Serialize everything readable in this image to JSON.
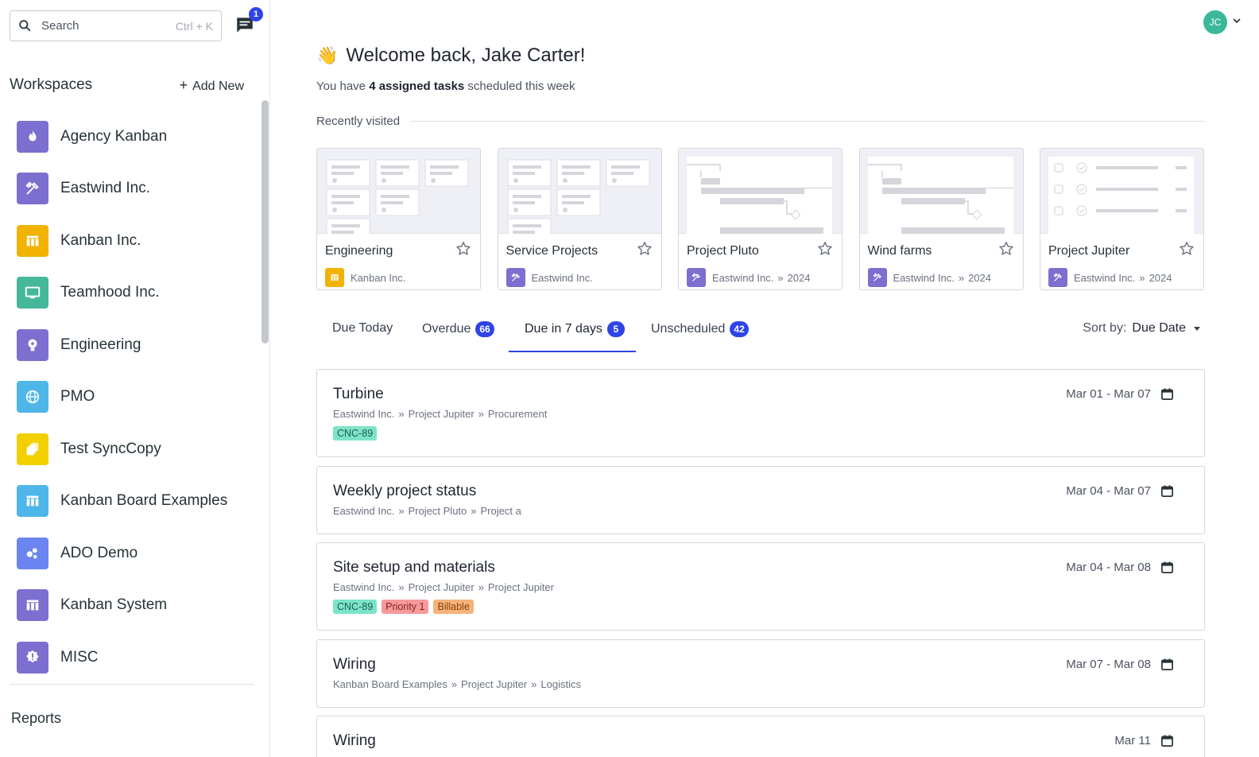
{
  "search": {
    "placeholder": "Search",
    "shortcut": "Ctrl + K"
  },
  "chat": {
    "badge": "1"
  },
  "sidebar": {
    "title": "Workspaces",
    "add_new": "Add New",
    "items": [
      {
        "label": "Agency Kanban",
        "icon": "fire-icon",
        "color": "#7c6fd0"
      },
      {
        "label": "Eastwind Inc.",
        "icon": "tools-icon",
        "color": "#7c6fd0"
      },
      {
        "label": "Kanban Inc.",
        "icon": "board-icon",
        "color": "#f2b200"
      },
      {
        "label": "Teamhood Inc.",
        "icon": "monitor-icon",
        "color": "#45b79a"
      },
      {
        "label": "Engineering",
        "icon": "bulb-icon",
        "color": "#7c6fd0"
      },
      {
        "label": "PMO",
        "icon": "globe-icon",
        "color": "#4fb6ea"
      },
      {
        "label": "Test SyncCopy",
        "icon": "copy-icon",
        "color": "#f2d000"
      },
      {
        "label": "Kanban Board Examples",
        "icon": "board-icon",
        "color": "#4fb6ea"
      },
      {
        "label": "ADO Demo",
        "icon": "bubbles-icon",
        "color": "#6b85f0"
      },
      {
        "label": "Kanban System",
        "icon": "board-icon",
        "color": "#7c6fd0"
      },
      {
        "label": "MISC",
        "icon": "alert-badge-icon",
        "color": "#7c6fd0"
      }
    ],
    "reports": "Reports"
  },
  "user": {
    "initials": "JC"
  },
  "welcome": {
    "emoji": "👋",
    "title": "Welcome back, Jake Carter!",
    "sub_prefix": "You have ",
    "sub_bold": "4 assigned tasks",
    "sub_suffix": " scheduled this week"
  },
  "recent": {
    "label": "Recently visited",
    "cards": [
      {
        "title": "Engineering",
        "thumb": "kanban",
        "workspace": "Kanban Inc.",
        "year": "",
        "icon": "board-icon",
        "color": "#f2b200"
      },
      {
        "title": "Service Projects",
        "thumb": "kanban",
        "workspace": "Eastwind Inc.",
        "year": "",
        "icon": "tools-icon",
        "color": "#7c6fd0"
      },
      {
        "title": "Project Pluto",
        "thumb": "gantt",
        "workspace": "Eastwind Inc.",
        "year": "2024",
        "icon": "tools-icon",
        "color": "#7c6fd0"
      },
      {
        "title": "Wind farms",
        "thumb": "gantt",
        "workspace": "Eastwind Inc.",
        "year": "2024",
        "icon": "tools-icon",
        "color": "#7c6fd0"
      },
      {
        "title": "Project Jupiter",
        "thumb": "list",
        "workspace": "Eastwind Inc.",
        "year": "2024",
        "icon": "tools-icon",
        "color": "#7c6fd0"
      }
    ]
  },
  "tabs": [
    {
      "label": "Due Today",
      "badge": ""
    },
    {
      "label": "Overdue",
      "badge": "66"
    },
    {
      "label": "Due in 7 days",
      "badge": "5",
      "active": true
    },
    {
      "label": "Unscheduled",
      "badge": "42"
    }
  ],
  "sort": {
    "label": "Sort by:",
    "value": "Due Date"
  },
  "tasks": [
    {
      "name": "Turbine",
      "path": [
        "Eastwind Inc.",
        "Project Jupiter",
        "Procurement"
      ],
      "date": "Mar 01 - Mar 07",
      "tags": [
        {
          "text": "CNC-89",
          "bg": "#7de3c8",
          "fg": "#1d5e4d"
        }
      ]
    },
    {
      "name": "Weekly project status",
      "path": [
        "Eastwind Inc.",
        "Project Pluto",
        "Project a"
      ],
      "date": "Mar 04 - Mar 07",
      "tags": []
    },
    {
      "name": "Site setup and materials",
      "path": [
        "Eastwind Inc.",
        "Project Jupiter",
        "Project Jupiter"
      ],
      "date": "Mar 04 - Mar 08",
      "tags": [
        {
          "text": "CNC-89",
          "bg": "#7de3c8",
          "fg": "#1d5e4d"
        },
        {
          "text": "Priority 1",
          "bg": "#f59a9a",
          "fg": "#8a1f1f"
        },
        {
          "text": "Billable",
          "bg": "#f6b37a",
          "fg": "#8a3d0b"
        }
      ]
    },
    {
      "name": "Wiring",
      "path": [
        "Kanban Board Examples",
        "Project Jupiter",
        "Logistics"
      ],
      "date": "Mar 07 - Mar 08",
      "tags": []
    },
    {
      "name": "Wiring",
      "path": [],
      "date": "Mar 11",
      "tags": []
    }
  ]
}
